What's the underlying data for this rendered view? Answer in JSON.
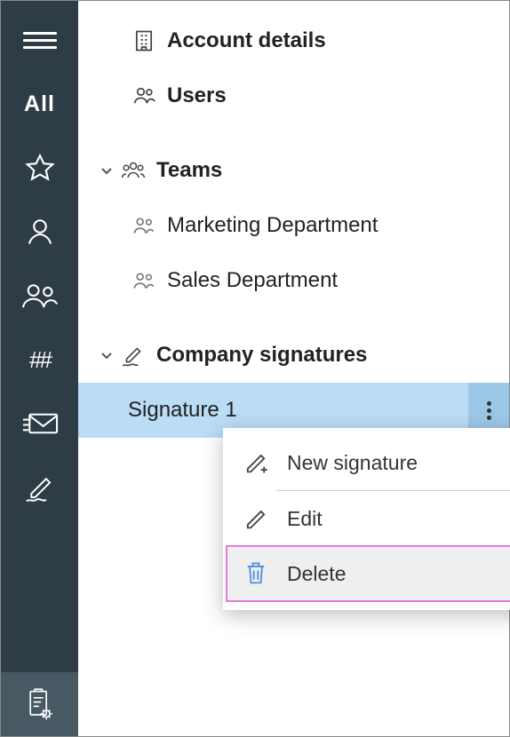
{
  "rail": {
    "all_label": "All",
    "hash_label": "##"
  },
  "tree": {
    "account_details": "Account details",
    "users": "Users",
    "teams": "Teams",
    "team_items": [
      "Marketing Department",
      "Sales Department"
    ],
    "signatures_section": "Company signatures",
    "signature_items": [
      "Signature 1"
    ]
  },
  "context_menu": {
    "new_signature": "New signature",
    "edit": "Edit",
    "delete": "Delete"
  }
}
